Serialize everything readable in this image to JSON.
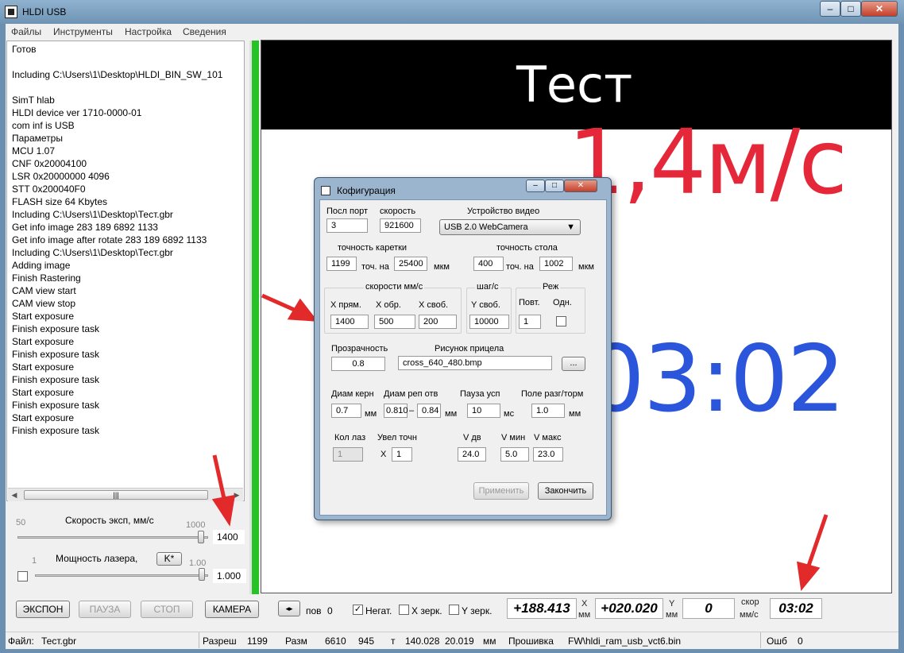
{
  "window": {
    "title": "HLDI USB",
    "btn_min": "–",
    "btn_max": "□",
    "btn_close": "✕"
  },
  "menu": [
    "Файлы",
    "Инструменты",
    "Настройка",
    "Сведения"
  ],
  "log": [
    "Готов",
    "",
    "Including C:\\Users\\1\\Desktop\\HLDI_BIN_SW_101",
    "",
    "SimT hlab",
    "HLDI device ver 1710-0000-01",
    "com inf is USB",
    "Параметры",
    "MCU 1.07",
    "CNF 0x20004100",
    "LSR 0x20000000 4096",
    "STT 0x200040F0",
    "FLASH size 64 Kbytes",
    "Including C:\\Users\\1\\Desktop\\Тест.gbr",
    "Get info image 283 189 6892 1133",
    "Get info image after rotate 283 189 6892 1133",
    "Including C:\\Users\\1\\Desktop\\Тест.gbr",
    "Adding image",
    "Finish Rastering",
    "CAM view start",
    "CAM view stop",
    "Start exposure",
    "Finish exposure task",
    "Start exposure",
    "Finish exposure task",
    "Start exposure",
    "Finish exposure task",
    "Start exposure",
    "Finish exposure task",
    "Start exposure",
    "Finish exposure task"
  ],
  "scroll": {
    "thumb": "|||"
  },
  "speed": {
    "label": "Скорость эксп, мм/с",
    "min": "50",
    "max": "1000",
    "value": "1400",
    "level": 0.98
  },
  "power": {
    "label": "Мощность лазера,",
    "k_button": "K*",
    "min": "1",
    "max": "1.00",
    "value": "1.000",
    "level": 0.98
  },
  "buttons": {
    "expose": "ЭКСПОН",
    "pause": "ПАУЗА",
    "stop": "СТОП",
    "camera": "КАМЕРА"
  },
  "viewer": {
    "title": "Тест",
    "speed_overlay": "1,4м/с",
    "timer_overlay": "03:02"
  },
  "bottom": {
    "pos_label": "пов",
    "pos_value": "0",
    "neg_label": "Негат.",
    "neg_checked": true,
    "xmirror": "X зерк.",
    "ymirror": "Y зерк.",
    "x_value": "+188.413",
    "x_axis": "X",
    "x_unit": "мм",
    "y_value": "+020.020",
    "y_axis": "Y",
    "y_unit": "мм",
    "speed_value": "0",
    "speed_label1": "скор",
    "speed_label2": "мм/с",
    "time_value": "03:02"
  },
  "status": {
    "file_label": "Файл:",
    "file": "Тест.gbr",
    "res_label": "Разреш",
    "res": "1199",
    "size_label": "Разм",
    "w": "6610",
    "h": "945",
    "t_label": "т",
    "t1": "140.028",
    "t2": "20.019",
    "unit": "мм",
    "fw_label": "Прошивка",
    "fw": "FW\\hldi_ram_usb_vct6.bin",
    "err_label": "Ошб",
    "err": "0"
  },
  "dialog": {
    "title": "Кофигурация",
    "port_label": "Посл порт",
    "port": "3",
    "baud_label": "скорость",
    "baud": "921600",
    "video_label": "Устройство видео",
    "video": "USB 2.0 WebCamera",
    "carriage_label": "точность каретки",
    "carriage_pts": "1199",
    "carriage_on": "точ. на",
    "carriage_um": "25400",
    "um": "мкм",
    "table_label": "точность стола",
    "table_pts": "400",
    "table_on": "точ. на",
    "table_um": "1002",
    "speeds_label": "скорости мм/с",
    "xfwd_label": "X прям.",
    "xfwd": "1400",
    "xrev_label": "X обр.",
    "xrev": "500",
    "xfree_label": "X своб.",
    "xfree": "200",
    "step_label": "шаг/с",
    "yfree_label": "Y своб.",
    "yfree": "10000",
    "mode_label": "Реж",
    "repeat_label": "Повт.",
    "repeat": "1",
    "single_label": "Одн.",
    "transp_label": "Прозрачность",
    "transp": "0.8",
    "reticle_label": "Рисунок прицела",
    "reticle": "cross_640_480.bmp",
    "browse": "...",
    "core_label": "Диам керн",
    "core": "0.7",
    "mm": "мм",
    "ref_label": "Диам реп отв",
    "ref1": "0.810",
    "dash": "–",
    "ref2": "0.84",
    "pause_label": "Пауза усп",
    "pause": "10",
    "ms": "мс",
    "field_label": "Поле разг/торм",
    "field": "1.0",
    "lasers_label": "Кол лаз",
    "lasers": "1",
    "zoom_label": "Увел точн",
    "zoom_x": "X",
    "zoom": "1",
    "vdv_label": "V дв",
    "vdv": "24.0",
    "vmin_label": "V мин",
    "vmin": "5.0",
    "vmax_label": "V макс",
    "vmax": "23.0",
    "apply": "Применить",
    "finish": "Закончить"
  }
}
